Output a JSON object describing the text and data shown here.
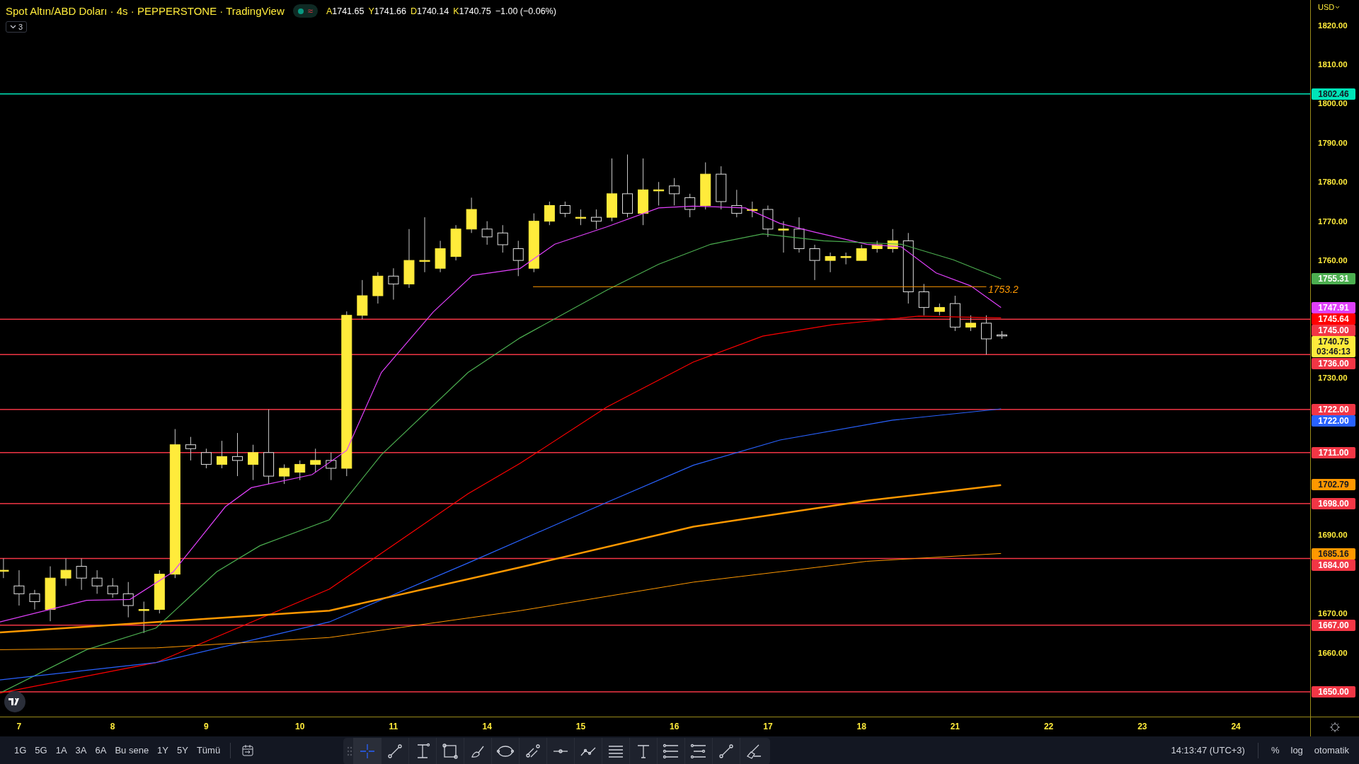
{
  "header": {
    "title": "Spot Altın/ABD Doları · 4s · PEPPERSTONE · TradingView",
    "status_symbol": "≈",
    "ohlc": [
      {
        "label": "A",
        "value": "1741.65"
      },
      {
        "label": "Y",
        "value": "1741.66"
      },
      {
        "label": "D",
        "value": "1740.14"
      },
      {
        "label": "K",
        "value": "1740.75"
      }
    ],
    "change": "−1.00 (−0.06%)",
    "indicators_count": "3"
  },
  "price_axis": {
    "currency": "USD",
    "ticks": [
      "1820.00",
      "1810.00",
      "1800.00",
      "1790.00",
      "1780.00",
      "1770.00",
      "1760.00",
      "1730.00",
      "1690.00",
      "1670.00",
      "1660.00"
    ],
    "tags": [
      {
        "kind": "level",
        "text": "1802.46",
        "color": "#00e5b8"
      },
      {
        "kind": "indicator",
        "text": "1755.31",
        "color": "#4caf50"
      },
      {
        "kind": "indicator",
        "text": "1747.91",
        "color": "#e040fb"
      },
      {
        "kind": "indicator",
        "text": "1745.64",
        "color": "#ff0000"
      },
      {
        "kind": "level",
        "text": "1745.00",
        "color": "#f23645"
      },
      {
        "kind": "last",
        "text": "1740.75",
        "sub": "03:46:13",
        "color": "#ffeb3b"
      },
      {
        "kind": "level",
        "text": "1736.00",
        "color": "#f23645"
      },
      {
        "kind": "level",
        "text": "1722.00",
        "color": "#f23645"
      },
      {
        "kind": "indicator",
        "text": "1722.00",
        "color": "#2962ff"
      },
      {
        "kind": "level",
        "text": "1711.00",
        "color": "#f23645"
      },
      {
        "kind": "indicator",
        "text": "1702.79",
        "color": "#ff9800"
      },
      {
        "kind": "level",
        "text": "1698.00",
        "color": "#f23645"
      },
      {
        "kind": "indicator",
        "text": "1685.16",
        "color": "#ff9800"
      },
      {
        "kind": "level",
        "text": "1684.00",
        "color": "#f23645"
      },
      {
        "kind": "level",
        "text": "1667.00",
        "color": "#f23645"
      },
      {
        "kind": "level",
        "text": "1650.00",
        "color": "#f23645"
      }
    ]
  },
  "annotation": "1753.2",
  "time_axis": [
    "7",
    "8",
    "9",
    "10",
    "11",
    "14",
    "15",
    "16",
    "17",
    "18",
    "21",
    "22",
    "23",
    "24"
  ],
  "bottom_bar": {
    "ranges": [
      "1G",
      "5G",
      "1A",
      "3A",
      "6A",
      "Bu sene",
      "1Y",
      "5Y",
      "Tümü"
    ],
    "tools": [
      {
        "selected": true
      },
      {
        "selected": false
      },
      {
        "selected": false
      },
      {
        "selected": false
      },
      {
        "selected": false
      },
      {
        "selected": false
      },
      {
        "selected": false
      },
      {
        "selected": false
      },
      {
        "selected": false
      },
      {
        "selected": false
      },
      {
        "selected": false
      },
      {
        "selected": false
      },
      {
        "selected": false
      },
      {
        "selected": false
      },
      {
        "selected": false
      }
    ],
    "clock": "14:13:47 (UTC+3)",
    "percent": "%",
    "log": "log",
    "scale_mode": "otomatik"
  }
}
